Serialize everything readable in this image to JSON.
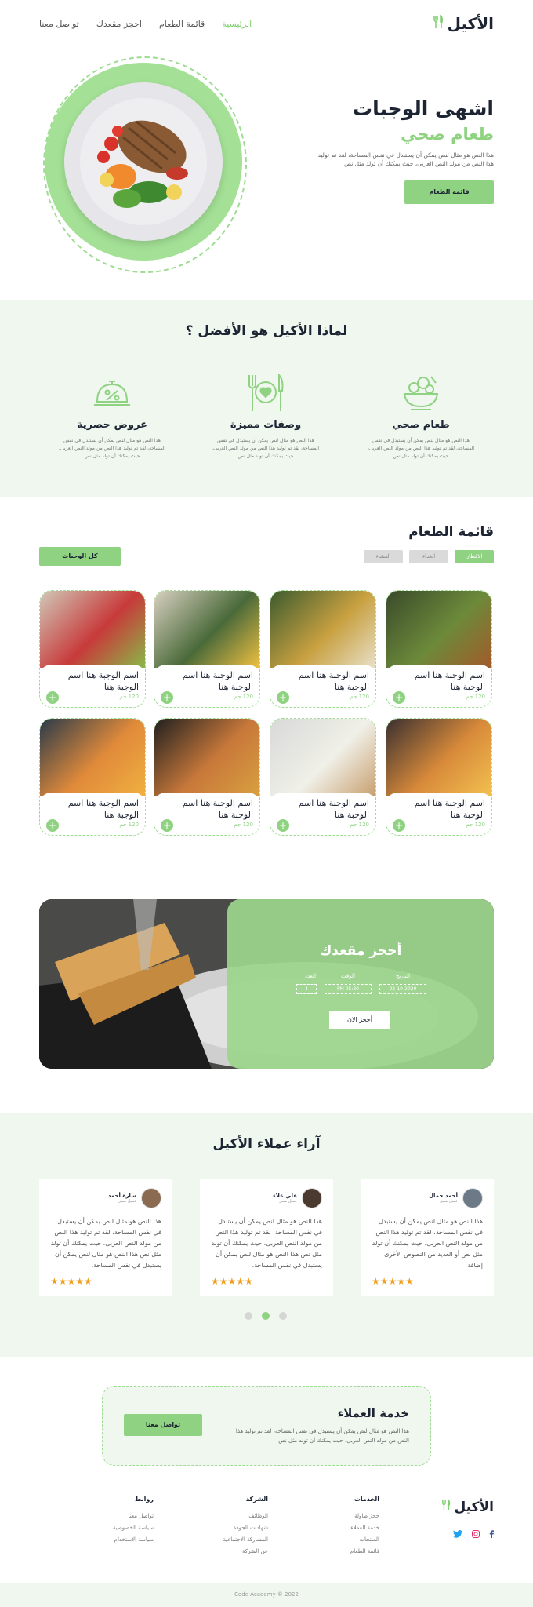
{
  "nav": {
    "logo": "الأكيل",
    "links": [
      "الرئيسية",
      "قائمة الطعام",
      "احجز مقعدك",
      "تواصل معنا"
    ]
  },
  "hero": {
    "title": "اشهى الوجبات",
    "subtitle": "طعام صحي",
    "text": "هذا النص هو مثال لنص يمكن أن يستبدل في نفس المساحة، لقد تم توليد هذا النص من مولد النص العربى، حيث يمكنك أن تولد مثل  نص",
    "button": "قائمة الطعام"
  },
  "why": {
    "title": "لماذا الأكيل هو الأفضل ؟",
    "features": [
      {
        "icon": "salad-bowl-icon",
        "title": "طعام صحي",
        "text": "هذا النص هو مثال لنص يمكن أن يستبدل في نفس المساحة، لقد تم توليد هذا النص من مولد النص العربى، حيث يمكنك أن تولد مثل  نص"
      },
      {
        "icon": "cutlery-heart-icon",
        "title": "وصفات مميزة",
        "text": "هذا النص هو مثال لنص يمكن أن يستبدل في نفس المساحة، لقد تم توليد هذا النص من مولد النص العربى، حيث يمكنك أن تولد مثل  نص"
      },
      {
        "icon": "discount-dish-icon",
        "title": "عروض حصرية",
        "text": "هذا النص هو مثال لنص يمكن أن يستبدل في نفس المساحة، لقد تم توليد هذا النص من مولد النص العربى، حيث يمكنك أن تولد مثل  نص"
      }
    ]
  },
  "menu": {
    "title": "قائمة الطعام",
    "tabs": [
      "الافطار",
      "الغداء",
      "العشاء"
    ],
    "all_button": "كل الوجبات",
    "item_name": "اسم الوجبة هنا اسم الوجبة هنا",
    "item_price": "120 جم",
    "add_symbol": "+"
  },
  "booking": {
    "title": "أحجز مقعدك",
    "labels": [
      "التاريخ",
      "الوقت",
      "العدد"
    ],
    "values": [
      "22-10-2020",
      "05:30 PM",
      "4"
    ],
    "button": "أحجز الان"
  },
  "testimonials": {
    "title": "آراء عملاء الأكيل",
    "items": [
      {
        "name": "أحمد جمال",
        "job": "عميل مميز",
        "text": "هذا النص هو مثال لنص يمكن أن يستبدل في نفس المساحة، لقد تم توليد هذا النص من مولد النص العربى، حيث يمكنك أن تولد مثل  نص أو العديد من النصوص الأخرى إضافة",
        "stars": "★★★★★"
      },
      {
        "name": "علي علاء",
        "job": "عميل مميز",
        "text": "هذا النص هو مثال لنص يمكن أن يستبدل في نفس المساحة، لقد تم توليد هذا النص من مولد النص العربى، حيث يمكنك أن تولد مثل  نص هذا النص هو مثال لنص يمكن أن يستبدل في نفس المساحة.",
        "stars": "★★★★★"
      },
      {
        "name": "سارة أحمد",
        "job": "عميل مميز",
        "text": "هذا النص هو مثال لنص يمكن أن يستبدل في نفس المساحة، لقد تم توليد هذا النص من مولد النص العربى، حيث يمكنك أن تولد مثل  نص هذا النص هو مثال لنص يمكن أن يستبدل في نفس المساحة.",
        "stars": "★★★★★"
      }
    ],
    "dots": 3,
    "active_dot": 1
  },
  "customer_service": {
    "title": "خدمة العملاء",
    "text": "هذا النص هو مثال لنص يمكن أن يستبدل في نفس المساحة، لقد تم توليد هذا النص من مولد النص العربى، حيث يمكنك أن تولد مثل  نص",
    "button": "تواصل معنا"
  },
  "footer": {
    "logo": "الأكيل",
    "social": [
      "facebook-icon",
      "instagram-icon",
      "twitter-icon"
    ],
    "columns": [
      {
        "title": "الخدمات",
        "links": [
          "حجز طاولة",
          "خدمة العملاء",
          "المنتجات",
          "قائمة الطعام"
        ]
      },
      {
        "title": "الشركة",
        "links": [
          "الوظائف",
          "شهادات الجودة",
          "المشاركة الاجتماعية",
          "عن الشركة"
        ]
      },
      {
        "title": "روابط",
        "links": [
          "تواصل معنا",
          "سياسة الخصوصية",
          "سياسة الاستخدام"
        ]
      }
    ],
    "copyright": "Code Academy © 2022"
  },
  "colors": {
    "accent": "#8fd282",
    "dark": "#1d2433",
    "soft_bg": "#eff7ee"
  }
}
